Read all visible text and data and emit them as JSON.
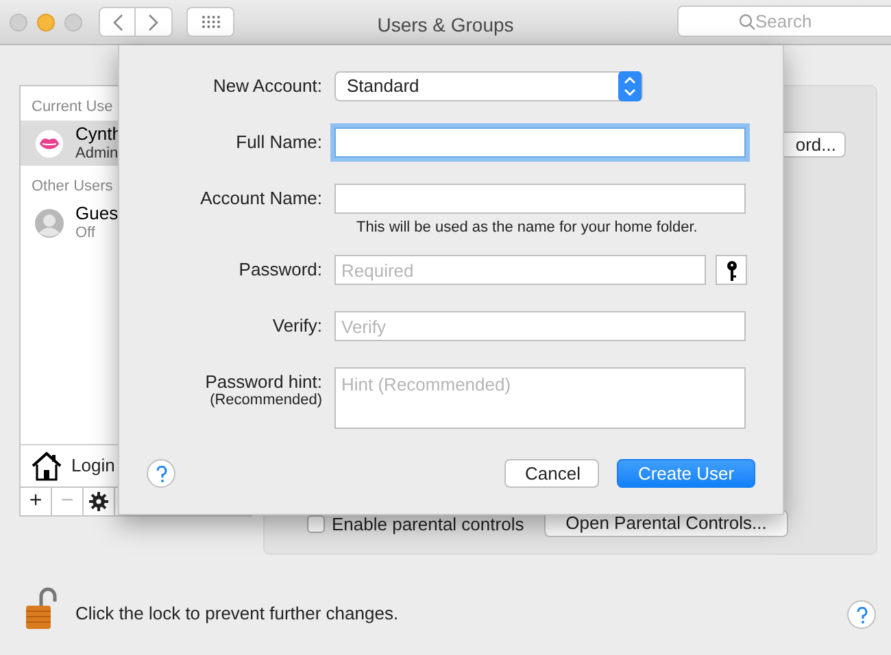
{
  "window": {
    "title": "Users & Groups",
    "search": {
      "placeholder": "Search"
    }
  },
  "sidebar": {
    "sections": [
      {
        "header": "Current Use",
        "users": [
          {
            "name": "Cynth",
            "role": "Admin",
            "selected": true,
            "kind": "lips"
          }
        ]
      },
      {
        "header": "Other Users",
        "users": [
          {
            "name": "Gues",
            "role": "Off",
            "selected": false,
            "kind": "silhouette"
          }
        ]
      }
    ],
    "login_options": "Login",
    "toolbar": [
      {
        "label": "+",
        "disabled": false
      },
      {
        "label": "−",
        "disabled": true
      }
    ]
  },
  "panel": {
    "password_button": "ord...",
    "parental_controls": {
      "label": "Enable parental controls",
      "checked": false
    },
    "open_parental_button": "Open Parental Controls..."
  },
  "sheet": {
    "fields": [
      {
        "kind": "popup",
        "label": "New Account:",
        "value": "Standard"
      },
      {
        "kind": "text",
        "label": "Full Name:",
        "focused": true
      },
      {
        "kind": "text",
        "label": "Account Name:",
        "focused": false,
        "hint": "This will be used as the name for your home folder."
      },
      {
        "kind": "password",
        "label": "Password:",
        "placeholder": "Required"
      },
      {
        "kind": "text",
        "label": "Verify:",
        "placeholder": "Verify",
        "focused": false
      },
      {
        "kind": "textarea",
        "label": "Password hint:",
        "sublabel": "(Recommended)",
        "placeholder": "Hint (Recommended)"
      }
    ],
    "buttons": [
      {
        "label": "Cancel",
        "default": false
      },
      {
        "label": "Create User",
        "default": true
      }
    ]
  },
  "footer": {
    "lock_text": "Click the lock to prevent further changes."
  }
}
